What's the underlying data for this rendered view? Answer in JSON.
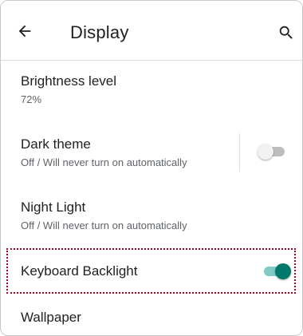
{
  "header": {
    "title": "Display",
    "back_icon": "arrow-left-icon",
    "search_icon": "search-icon"
  },
  "settings": [
    {
      "title": "Brightness level",
      "summary": "72%"
    },
    {
      "title": "Dark theme",
      "summary": "Off / Will never turn on automatically",
      "switch_on": false
    },
    {
      "title": "Night Light",
      "summary": "Off / Will never turn on automatically"
    },
    {
      "title": "Keyboard Backlight",
      "switch_on": true
    },
    {
      "title": "Wallpaper"
    }
  ],
  "colors": {
    "accent": "#00796b",
    "accent_track": "#80cbc4",
    "switch_off_thumb": "#f1f1f1",
    "switch_off_track": "#bdbdbd",
    "highlight": "#b00020"
  }
}
